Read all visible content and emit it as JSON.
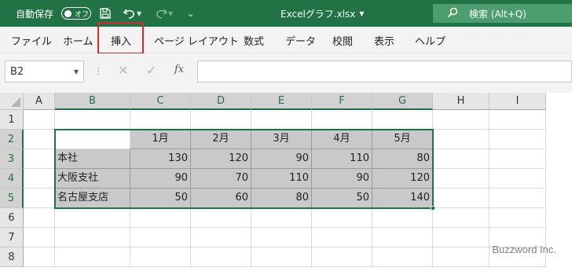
{
  "titlebar": {
    "autosave_label": "自動保存",
    "autosave_state": "オフ",
    "qat_more": "⌄",
    "filename": "Excelグラフ.xlsx",
    "search_placeholder": "検索 (Alt+Q)"
  },
  "ribbon": {
    "tabs": [
      "ファイル",
      "ホーム",
      "挿入",
      "ページ レイアウト",
      "数式",
      "データ",
      "校閲",
      "表示",
      "ヘルプ"
    ],
    "highlighted_tab": "挿入"
  },
  "formula_bar": {
    "name_box": "B2",
    "formula": ""
  },
  "grid": {
    "columns": [
      "A",
      "B",
      "C",
      "D",
      "E",
      "F",
      "G",
      "H",
      "I"
    ],
    "rows": [
      "1",
      "2",
      "3",
      "4",
      "5",
      "6",
      "7",
      "8"
    ],
    "selected_range": "B2:G5",
    "table": {
      "header": [
        "",
        "1月",
        "2月",
        "3月",
        "4月",
        "5月"
      ],
      "rows": [
        [
          "本社",
          "130",
          "120",
          "90",
          "110",
          "80"
        ],
        [
          "大阪支社",
          "90",
          "70",
          "110",
          "90",
          "120"
        ],
        [
          "名古屋支店",
          "50",
          "60",
          "80",
          "50",
          "140"
        ]
      ]
    }
  },
  "watermark": "Buzzword Inc.",
  "colors": {
    "titlebar": "#217346",
    "selection": "#217346",
    "highlight_box": "#e0262a",
    "table_fill": "#c9c9c9"
  }
}
